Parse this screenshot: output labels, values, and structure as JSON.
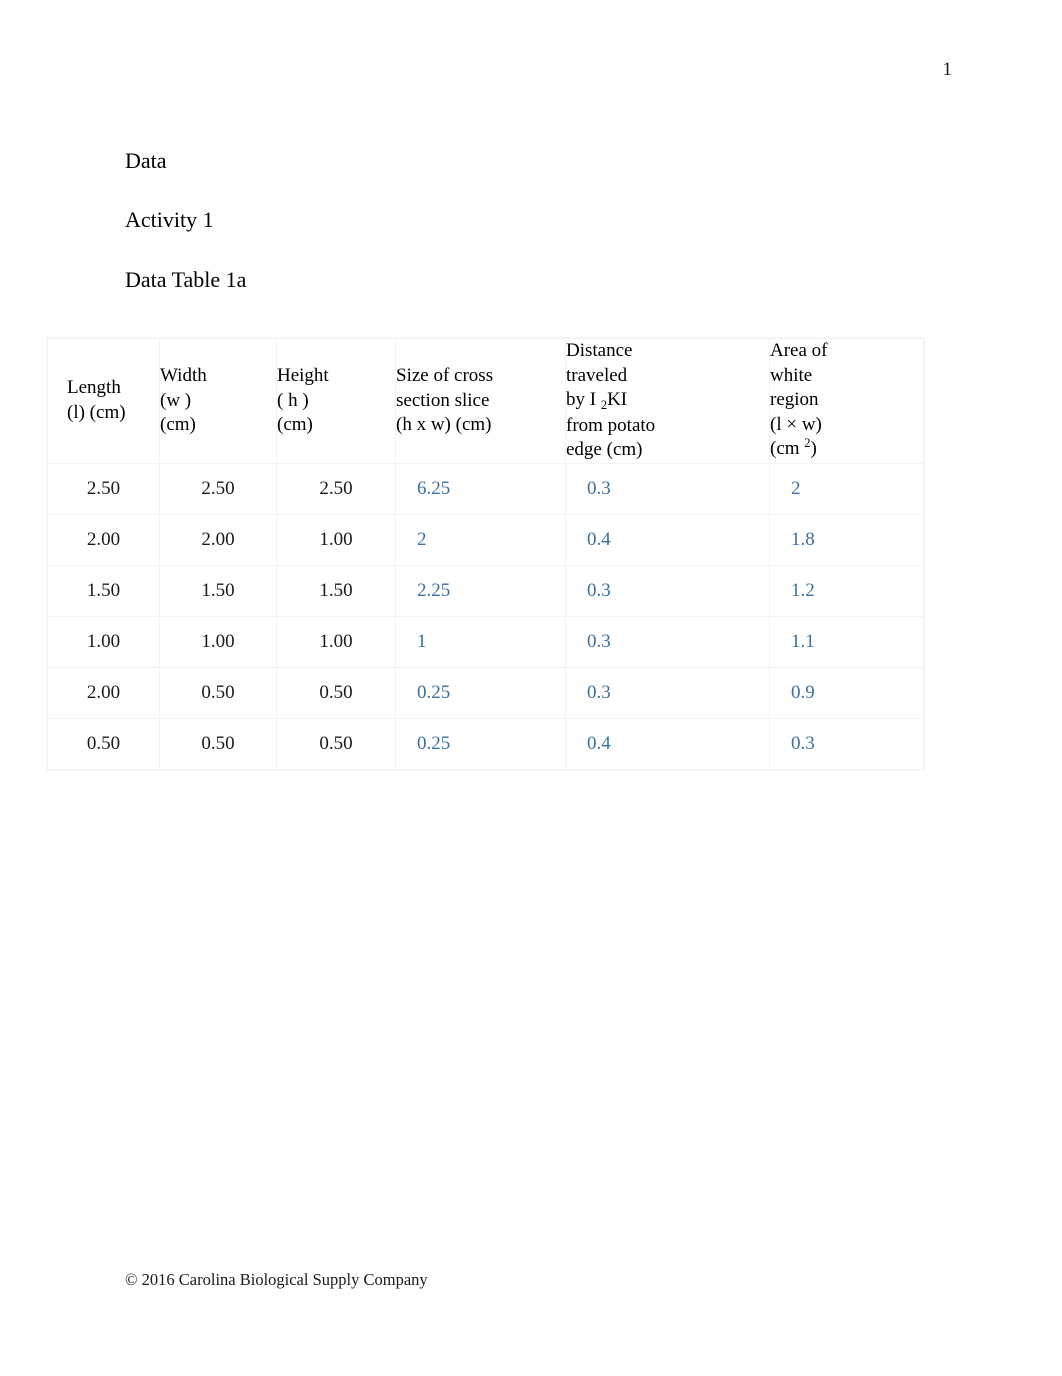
{
  "page": {
    "number": "1",
    "footer": "© 2016 Carolina Biological Supply Company"
  },
  "headings": {
    "section": "Data",
    "activity": "Activity 1",
    "table_label": "Data Table 1a"
  },
  "table": {
    "headers": [
      {
        "line1": "Length",
        "line2": "(l) (cm)",
        "line3": "",
        "line4": "",
        "line5": ""
      },
      {
        "line1": "Width",
        "line2": "(w )",
        "line3": "(cm)",
        "line4": "",
        "line5": ""
      },
      {
        "line1": "Height",
        "line2": "( h )",
        "line3": "(cm)",
        "line4": "",
        "line5": ""
      },
      {
        "line1": "Size of cross",
        "line2": "section slice",
        "line3": "(h x w) (cm)",
        "line4": "",
        "line5": ""
      },
      {
        "line1": "Distance",
        "line2": "traveled",
        "line3_pre": "by I ",
        "line3_sub": "2",
        "line3_post": "KI",
        "line4": "from potato",
        "line5": "edge (cm)"
      },
      {
        "line1": "Area of",
        "line2": "white",
        "line3": "region",
        "line4": "(l × w)",
        "line5_pre": "(cm ",
        "line5_sup": "2",
        "line5_post": ")"
      }
    ],
    "rows": [
      {
        "length": "2.50",
        "width": "2.50",
        "height": "2.50",
        "cross_section": "6.25",
        "distance": "0.3",
        "area": "2"
      },
      {
        "length": "2.00",
        "width": "2.00",
        "height": "1.00",
        "cross_section": "2",
        "distance": "0.4",
        "area": "1.8"
      },
      {
        "length": "1.50",
        "width": "1.50",
        "height": "1.50",
        "cross_section": "2.25",
        "distance": "0.3",
        "area": "1.2"
      },
      {
        "length": "1.00",
        "width": "1.00",
        "height": "1.00",
        "cross_section": "1",
        "distance": "0.3",
        "area": "1.1"
      },
      {
        "length": "2.00",
        "width": "0.50",
        "height": "0.50",
        "cross_section": "0.25",
        "distance": "0.3",
        "area": "0.9"
      },
      {
        "length": "0.50",
        "width": "0.50",
        "height": "0.50",
        "cross_section": "0.25",
        "distance": "0.4",
        "area": "0.3"
      }
    ]
  },
  "colors": {
    "calculated_value": "#3b6f9f",
    "text": "#000000",
    "border": "#f3f3f3"
  }
}
